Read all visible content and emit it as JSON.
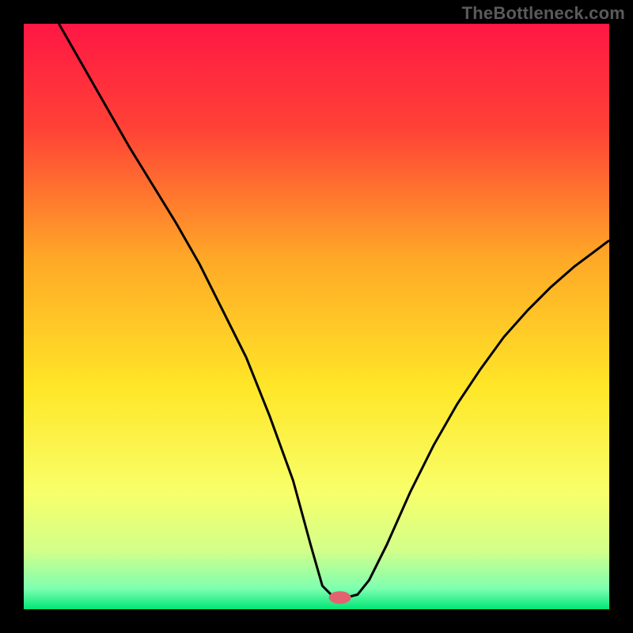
{
  "watermark": "TheBottleneck.com",
  "chart_data": {
    "type": "line",
    "title": "",
    "xlabel": "",
    "ylabel": "",
    "xlim": [
      0,
      100
    ],
    "ylim": [
      0,
      100
    ],
    "grid": false,
    "legend": false,
    "gradient_stops": [
      {
        "offset": 0,
        "color": "#ff1744"
      },
      {
        "offset": 0.18,
        "color": "#ff4236"
      },
      {
        "offset": 0.4,
        "color": "#ffa827"
      },
      {
        "offset": 0.62,
        "color": "#ffe627"
      },
      {
        "offset": 0.8,
        "color": "#f8ff6a"
      },
      {
        "offset": 0.9,
        "color": "#d2ff8a"
      },
      {
        "offset": 0.965,
        "color": "#7dffb0"
      },
      {
        "offset": 1.0,
        "color": "#00e676"
      }
    ],
    "marker": {
      "x": 54,
      "y": 2,
      "color": "#e2636f",
      "rx": 5,
      "ry": 3
    },
    "series": [
      {
        "name": "curve",
        "color": "#000000",
        "x": [
          6,
          10,
          14,
          18,
          22,
          26,
          30,
          34,
          38,
          42,
          46,
          49,
          51,
          53,
          55,
          57,
          59,
          62,
          66,
          70,
          74,
          78,
          82,
          86,
          90,
          94,
          98,
          100
        ],
        "values": [
          100,
          93,
          86,
          79,
          72.5,
          66,
          59,
          51,
          43,
          33,
          22,
          11,
          4,
          2,
          2,
          2.5,
          5,
          11,
          20,
          28,
          35,
          41,
          46.5,
          51,
          55,
          58.5,
          61.5,
          63
        ]
      }
    ]
  }
}
